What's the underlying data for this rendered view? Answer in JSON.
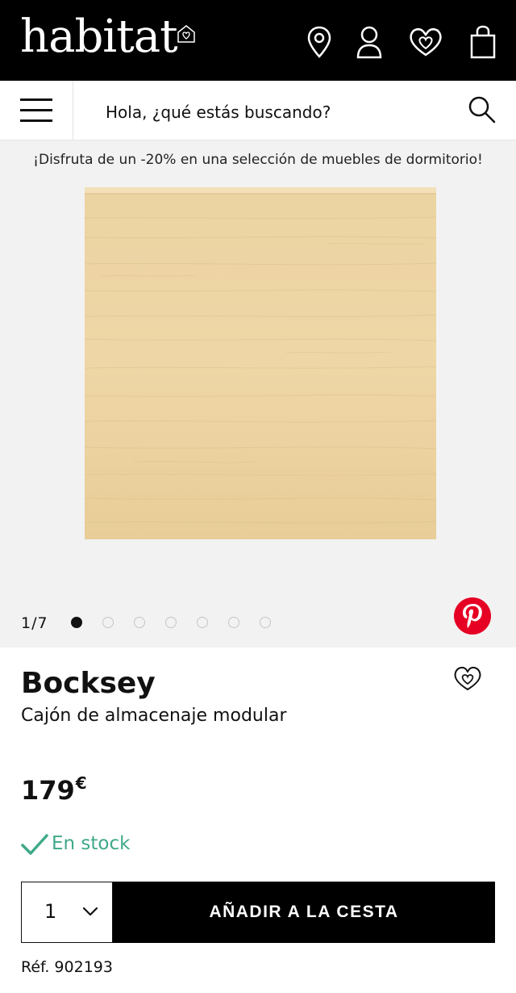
{
  "header": {
    "logo_text": "habitat",
    "icons": [
      "heart-house-icon",
      "location-pin-icon",
      "account-icon",
      "wishlist-heart-icon",
      "shopping-bag-icon"
    ],
    "background": "#000000"
  },
  "search": {
    "placeholder": "Hola, ¿qué estás buscando?"
  },
  "promo": {
    "text": "¡Disfruta de un -20% en una selección de muebles de dormitorio!"
  },
  "gallery": {
    "counter": "1/7",
    "total_images": 7,
    "active_index": 1,
    "background": "#f2f2f2"
  },
  "product": {
    "name": "Bocksey",
    "description": "Cajón de almacenaje modular",
    "price": "179",
    "currency": "€",
    "stock_text": "En stock",
    "stock_color": "#3fa98a",
    "quantity": "1",
    "add_to_cart_label": "AÑADIR A LA CESTA",
    "reference": "Réf. 902193"
  }
}
